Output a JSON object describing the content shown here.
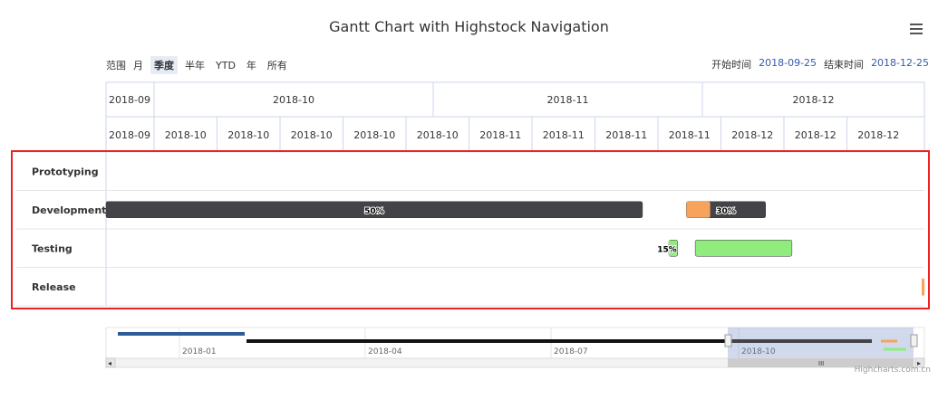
{
  "title": "Gantt Chart with Highstock Navigation",
  "range_selector": {
    "label": "范围",
    "buttons": [
      "月",
      "季度",
      "半年",
      "YTD",
      "年",
      "所有"
    ],
    "selected_index": 1
  },
  "date_inputs": {
    "from_label": "开始时间",
    "from_value": "2018-09-25",
    "to_label": "结束时间",
    "to_value": "2018-12-25"
  },
  "credits": "Highcharts.com.cn",
  "chart_data": {
    "type": "gantt",
    "title": "Gantt Chart with Highstock Navigation",
    "x_range": [
      "2018-09-25",
      "2018-12-25"
    ],
    "axis_top_ticks": [
      "2018-09",
      "2018-10",
      "2018-11",
      "2018-12"
    ],
    "axis_bottom_ticks": [
      "2018-09",
      "2018-10",
      "2018-10",
      "2018-10",
      "2018-10",
      "2018-10",
      "2018-11",
      "2018-11",
      "2018-11",
      "2018-11",
      "2018-12",
      "2018-12",
      "2018-12"
    ],
    "categories": [
      "Prototyping",
      "Development",
      "Testing",
      "Release"
    ],
    "tasks": [
      {
        "category": "Development",
        "start": "2018-09-25",
        "end": "2018-11-25",
        "completed": 0.5,
        "label": "50%",
        "color": "#434348",
        "partial_color": "#434348"
      },
      {
        "category": "Development",
        "start": "2018-11-30",
        "end": "2018-12-09",
        "completed": 0.3,
        "label": "30%",
        "color": "#434348",
        "partial_color": "#f7a35c"
      },
      {
        "category": "Testing",
        "start": "2018-11-28",
        "end": "2018-11-29",
        "completed": 0.15,
        "label": "15%",
        "color": "#90ed7d",
        "partial_color": "#90ed7d"
      },
      {
        "category": "Testing",
        "start": "2018-12-01",
        "end": "2018-12-12",
        "completed": 0,
        "label": "",
        "color": "#90ed7d",
        "partial_color": "#90ed7d"
      },
      {
        "category": "Release",
        "start": "2018-12-27",
        "end": "2018-12-27",
        "milestone": true,
        "label": "",
        "color": "#f7a35c"
      }
    ],
    "navigator": {
      "ticks": [
        "2018-01",
        "2018-04",
        "2018-07",
        "2018-10"
      ],
      "selected_range": [
        "2018-09-25",
        "2018-12-25"
      ]
    }
  }
}
